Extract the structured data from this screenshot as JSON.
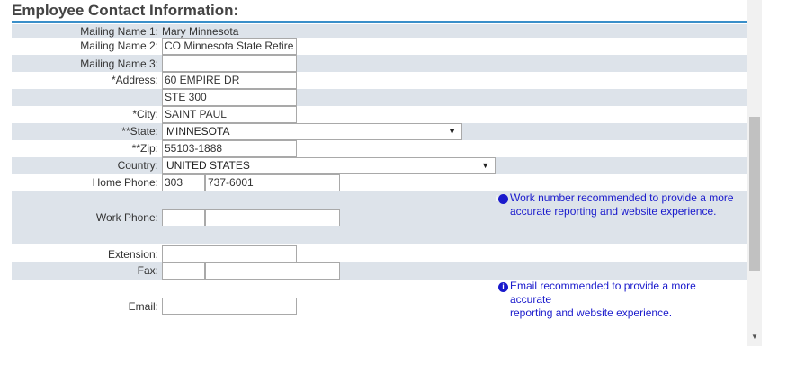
{
  "section": {
    "title": "Employee Contact Information:"
  },
  "fields": {
    "mailing_name_1": {
      "label": "Mailing Name 1:",
      "value": "Mary Minnesota"
    },
    "mailing_name_2": {
      "label": "Mailing Name 2:",
      "value": "CO Minnesota State Retire"
    },
    "mailing_name_3": {
      "label": "Mailing Name 3:",
      "value": ""
    },
    "address": {
      "label": "*Address:",
      "line1": "60 EMPIRE DR",
      "line2": "STE 300"
    },
    "city": {
      "label": "*City:",
      "value": "SAINT PAUL"
    },
    "state": {
      "label": "**State:",
      "value": "MINNESOTA"
    },
    "zip": {
      "label": "**Zip:",
      "value": "55103-1888"
    },
    "country": {
      "label": "Country:",
      "value": "UNITED STATES"
    },
    "home_phone": {
      "label": "Home Phone:",
      "area": "303",
      "number": "737-6001"
    },
    "work_phone": {
      "label": "Work Phone:",
      "area": "",
      "number": "",
      "note": "Work number recommended to provide a more accurate reporting and website experience."
    },
    "extension": {
      "label": "Extension:",
      "value": ""
    },
    "fax": {
      "label": "Fax:",
      "area": "",
      "number": ""
    },
    "email": {
      "label": "Email:",
      "value": "",
      "note_line1": "Email recommended to provide a more",
      "note_line2": "accurate",
      "note_line3": "reporting and website experience."
    }
  },
  "icons": {
    "info": "info-icon",
    "dropdown": "chevron-down-icon"
  },
  "colors": {
    "accent": "#3a8fc9",
    "row_shade": "#dde3ea",
    "note": "#1a1acc"
  }
}
